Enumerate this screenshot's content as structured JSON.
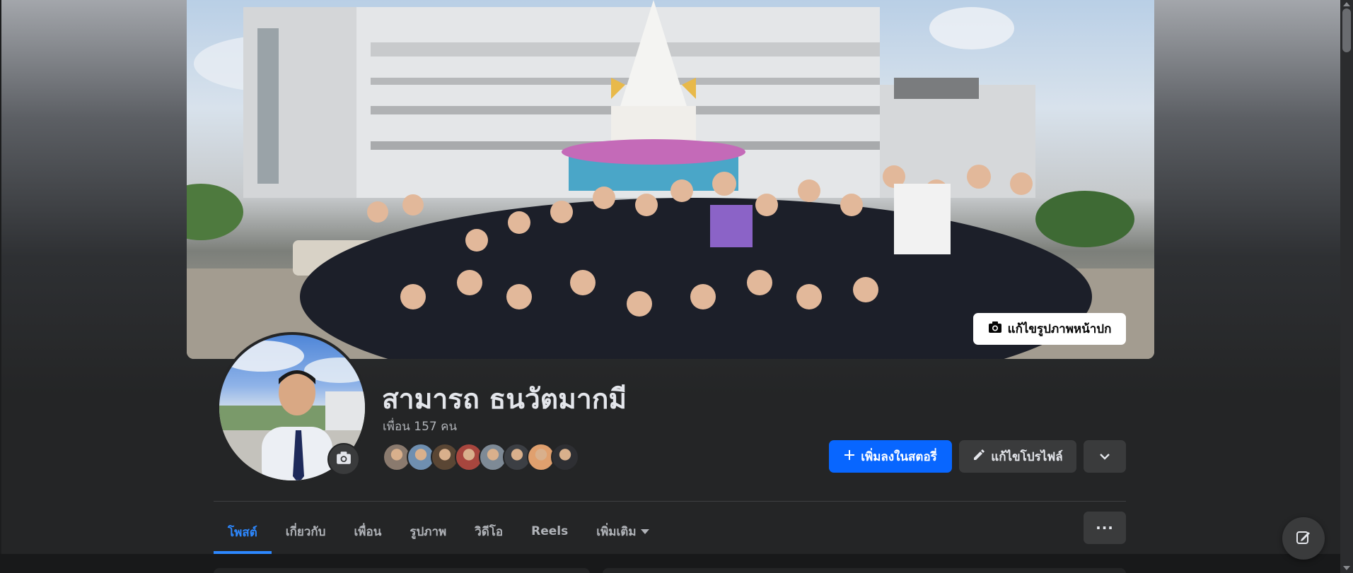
{
  "cover": {
    "edit_label": "แก้ไขรูปภาพหน้าปก",
    "edit_icon": "camera-icon"
  },
  "profile": {
    "name": "สามารถ ธนวัตมากมี",
    "friends_count": "เพื่อน 157 คน",
    "avatar_camera_icon": "camera-icon",
    "friend_avatar_colors": [
      "#8a7a6e",
      "#6f8fb0",
      "#5a4634",
      "#a8463e",
      "#7e8a96",
      "#3c3f44",
      "#e0a06e",
      "#2e2f33"
    ]
  },
  "actions": {
    "add_story_label": "เพิ่มลงในสตอรี่",
    "add_story_icon": "plus-icon",
    "edit_profile_label": "แก้ไขโปรไฟล์",
    "edit_profile_icon": "pencil-icon",
    "dropdown_icon": "chevron-down-icon"
  },
  "tabs": {
    "items": [
      {
        "label": "โพสต์",
        "active": true
      },
      {
        "label": "เกี่ยวกับ",
        "active": false
      },
      {
        "label": "เพื่อน",
        "active": false
      },
      {
        "label": "รูปภาพ",
        "active": false
      },
      {
        "label": "วิดีโอ",
        "active": false
      },
      {
        "label": "Reels",
        "active": false
      },
      {
        "label": "เพิ่มเติม",
        "active": false
      }
    ],
    "more_label": "···"
  },
  "colors": {
    "accent": "#0866ff",
    "active_tab": "#2d88ff",
    "background": "#242526",
    "secondary_button": "#3a3b3c"
  },
  "compose": {
    "icon": "compose-icon"
  }
}
